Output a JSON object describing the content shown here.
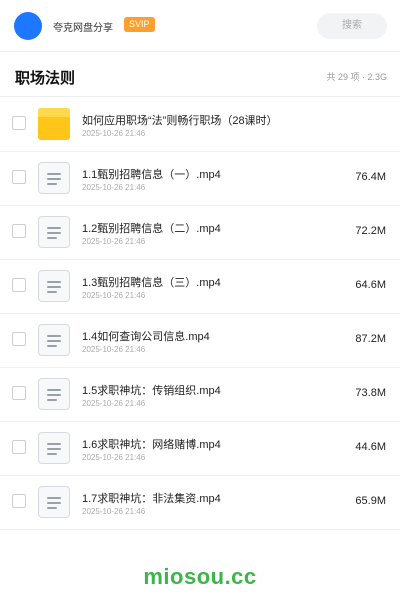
{
  "header": {
    "brand": "夸克网盘分享",
    "badge": "SVIP",
    "search_placeholder": "搜索",
    "avatar_color": "#1e78ff"
  },
  "folder_title": "职场法则",
  "summary": "共 29 项 · 2.3G",
  "files": [
    {
      "name": "如何应用职场“法”则畅行职场（28课时）",
      "date": "2025-10-26 21:46",
      "size": "",
      "icon": "folder-icon"
    },
    {
      "name": "1.1甄别招聘信息（一）.mp4",
      "date": "2025-10-26 21:46",
      "size": "76.4M",
      "icon": "file-icon"
    },
    {
      "name": "1.2甄别招聘信息（二）.mp4",
      "date": "2025-10-26 21:46",
      "size": "72.2M",
      "icon": "file-icon"
    },
    {
      "name": "1.3甄别招聘信息（三）.mp4",
      "date": "2025-10-26 21:46",
      "size": "64.6M",
      "icon": "file-icon"
    },
    {
      "name": "1.4如何查询公司信息.mp4",
      "date": "2025-10-26 21:46",
      "size": "87.2M",
      "icon": "file-icon"
    },
    {
      "name": "1.5求职神坑：传销组织.mp4",
      "date": "2025-10-26 21:46",
      "size": "73.8M",
      "icon": "file-icon"
    },
    {
      "name": "1.6求职神坑：网络赌博.mp4",
      "date": "2025-10-26 21:46",
      "size": "44.6M",
      "icon": "file-icon"
    },
    {
      "name": "1.7求职神坑：非法集资.mp4",
      "date": "2025-10-26 21:46",
      "size": "65.9M",
      "icon": "file-icon"
    }
  ],
  "watermark": "miosou.cc",
  "colors": {
    "accent": "#1e78ff",
    "svip": "#ff9f2b",
    "folder": "#ffc619",
    "watermark": "#3cb54a"
  }
}
